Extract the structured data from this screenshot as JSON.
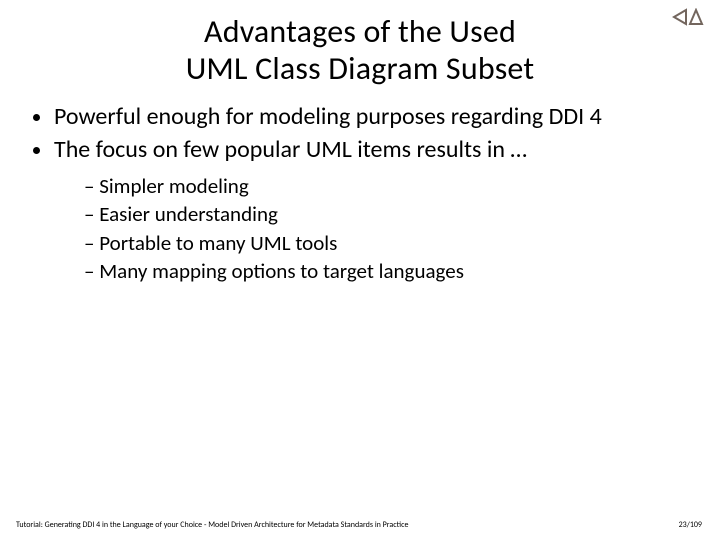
{
  "title_line1": "Advantages of the Used",
  "title_line2": "UML Class Diagram Subset",
  "bullets": {
    "item1": "Powerful enough for modeling purposes regarding DDI 4",
    "item2": "The focus on few popular UML items results in …",
    "sub1": "Simpler modeling",
    "sub2": "Easier understanding",
    "sub3": "Portable to many UML tools",
    "sub4": "Many mapping options to target languages"
  },
  "footer": "Tutorial: Generating DDI 4 in the Language of your Choice -  Model Driven Architecture for Metadata Standards in Practice",
  "page": "23/109",
  "logo_name": "ddi-alliance-logo"
}
